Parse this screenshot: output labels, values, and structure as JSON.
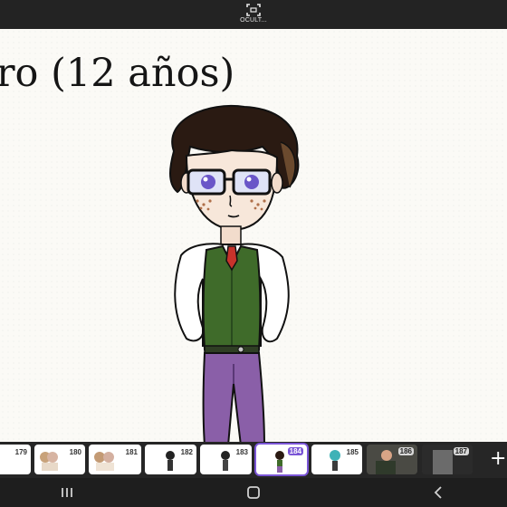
{
  "top_bar": {
    "hide_label": "OCULT..."
  },
  "canvas": {
    "caption": "ro (12 años)"
  },
  "filmstrip": {
    "frames": [
      {
        "number": "179"
      },
      {
        "number": "180"
      },
      {
        "number": "181"
      },
      {
        "number": "182"
      },
      {
        "number": "183"
      },
      {
        "number": "184",
        "selected": true
      },
      {
        "number": "185"
      },
      {
        "number": "186"
      },
      {
        "number": "187"
      }
    ],
    "add_label": "+"
  },
  "navbar": {
    "recents_icon": "recents-icon",
    "home_icon": "home-icon",
    "back_icon": "back-icon"
  },
  "colors": {
    "selected_accent": "#7a55d6",
    "vest": "#3f6b2a",
    "pants": "#8a5fa8",
    "hair": "#2a1a12"
  }
}
